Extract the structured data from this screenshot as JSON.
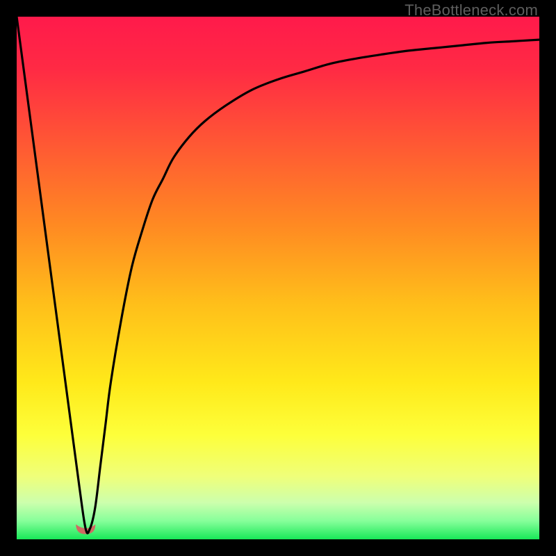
{
  "watermark": "TheBottleneck.com",
  "gradient": {
    "stops": [
      {
        "offset": 0.0,
        "color": "#ff1a4b"
      },
      {
        "offset": 0.1,
        "color": "#ff2a44"
      },
      {
        "offset": 0.25,
        "color": "#ff5a33"
      },
      {
        "offset": 0.4,
        "color": "#ff8a22"
      },
      {
        "offset": 0.55,
        "color": "#ffbf1a"
      },
      {
        "offset": 0.7,
        "color": "#ffe91a"
      },
      {
        "offset": 0.8,
        "color": "#fdff3a"
      },
      {
        "offset": 0.88,
        "color": "#efff7a"
      },
      {
        "offset": 0.93,
        "color": "#ccffad"
      },
      {
        "offset": 0.965,
        "color": "#86ff9a"
      },
      {
        "offset": 1.0,
        "color": "#18e858"
      }
    ]
  },
  "chart_data": {
    "type": "line",
    "title": "",
    "xlabel": "",
    "ylabel": "",
    "xlim": [
      0,
      100
    ],
    "ylim": [
      0,
      100
    ],
    "series": [
      {
        "name": "curve",
        "x": [
          0,
          2,
          4,
          6,
          8,
          10,
          12,
          13.2,
          14,
          15,
          16,
          17,
          18,
          20,
          22,
          24,
          26,
          28,
          30,
          33,
          36,
          40,
          45,
          50,
          55,
          60,
          65,
          70,
          75,
          80,
          85,
          90,
          95,
          100
        ],
        "y": [
          100,
          85,
          70,
          55,
          40,
          25,
          10,
          2,
          2,
          6,
          14,
          22,
          30,
          42,
          52,
          59,
          65,
          69,
          73,
          77,
          80,
          83,
          86,
          88,
          89.5,
          91,
          92,
          92.8,
          93.5,
          94,
          94.5,
          95,
          95.3,
          95.6
        ]
      }
    ],
    "marker": {
      "cx_pct": 13.2,
      "cy_pct": 2.3,
      "r": 14,
      "color": "#cf6a62"
    }
  }
}
